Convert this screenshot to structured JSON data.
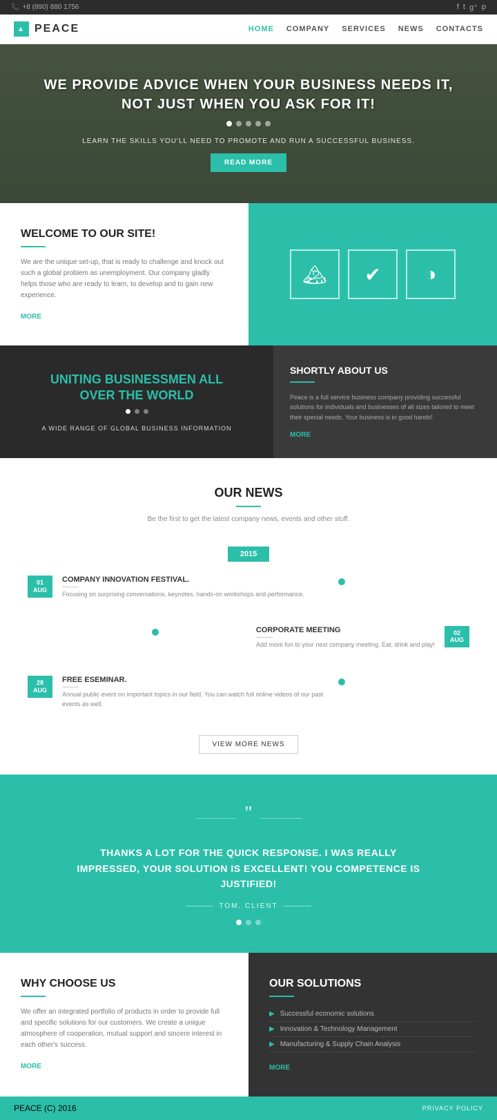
{
  "topbar": {
    "phone": "+8 (890) 880 1756",
    "social": [
      "f",
      "t",
      "g+",
      "p"
    ]
  },
  "header": {
    "logo_text": "PEACE",
    "nav": [
      {
        "label": "HOME",
        "active": true
      },
      {
        "label": "COMPANY"
      },
      {
        "label": "SERVICES"
      },
      {
        "label": "NEWS"
      },
      {
        "label": "CONTACTS"
      }
    ]
  },
  "hero": {
    "title_line1": "WE PROVIDE ADVICE WHEN YOUR BUSINESS NEEDS IT,",
    "title_line2": "NOT JUST WHEN YOU ASK FOR IT!",
    "subtext": "LEARN THE SKILLS YOU'LL NEED TO PROMOTE AND RUN A SUCCESSFUL BUSINESS.",
    "cta": "READ MORE",
    "dots": [
      true,
      false,
      false,
      false,
      false
    ]
  },
  "welcome": {
    "title": "WELCOME TO OUR SITE!",
    "body": "We are the unique set-up, that is ready to challenge and knock out such a global problem as unemployment. Our company gladly helps those who are ready to learn, to develop and to gain new experience.",
    "more": "MORE",
    "icons": [
      "mountain-icon",
      "check-icon",
      "clock-icon"
    ]
  },
  "banner": {
    "headline1": "UNITING BUSINESSMEN ALL",
    "headline2": "OVER THE WORLD",
    "subtext": "A WIDE RANGE OF GLOBAL BUSINESS INFORMATION",
    "about_title": "SHORTLY ABOUT US",
    "about_body": "Peace is a full service business company providing successful solutions for individuals and businesses of all sizes tailored to meet their special needs. Your business is in good hands!",
    "about_more": "MORE"
  },
  "news": {
    "title": "OUR NEWS",
    "description": "Be the first to get the latest company news, events and other stuff.",
    "year": "2015",
    "items": [
      {
        "day": "01",
        "month": "AUG",
        "title": "COMPANY INNOVATION FESTIVAL.",
        "body": "Focusing on surprising conversations, keynotes, hands-on workshops and performance.",
        "side": "left"
      },
      {
        "day": "02",
        "month": "AUG",
        "title": "CORPORATE MEETING",
        "body": "Add more fun to your next company meeting. Eat, drink and play!",
        "side": "right"
      },
      {
        "day": "28",
        "month": "AUG",
        "title": "FREE ESEMINAR.",
        "body": "Annual public event on important topics in our field. You can watch full online videos of our past events as well.",
        "side": "left"
      }
    ],
    "view_more": "VIEW MORE NEWS"
  },
  "testimonial": {
    "quote": "THANKS A LOT FOR THE QUICK RESPONSE. I WAS REALLY IMPRESSED, YOUR SOLUTION IS EXCELLENT! YOU COMPETENCE IS JUSTIFIED!",
    "author": "TOM, CLIENT",
    "dots": [
      true,
      false,
      false
    ]
  },
  "why": {
    "title": "WHY CHOOSE US",
    "body": "We offer an integrated portfolio of products in order to provide full and specific solutions for our customers. We create a unique atmosphere of cooperation, mutual support and sincere interest in each other's success.",
    "more": "MORE"
  },
  "solutions": {
    "title": "OUR SOLUTIONS",
    "items": [
      "Successful economic solutions",
      "Innovation & Technology Management",
      "Manufacturing & Supply Chain Analysis"
    ],
    "more": "MORE"
  },
  "footer": {
    "copy": "PEACE (C) 2016",
    "policy": "PRIVACY POLICY"
  }
}
